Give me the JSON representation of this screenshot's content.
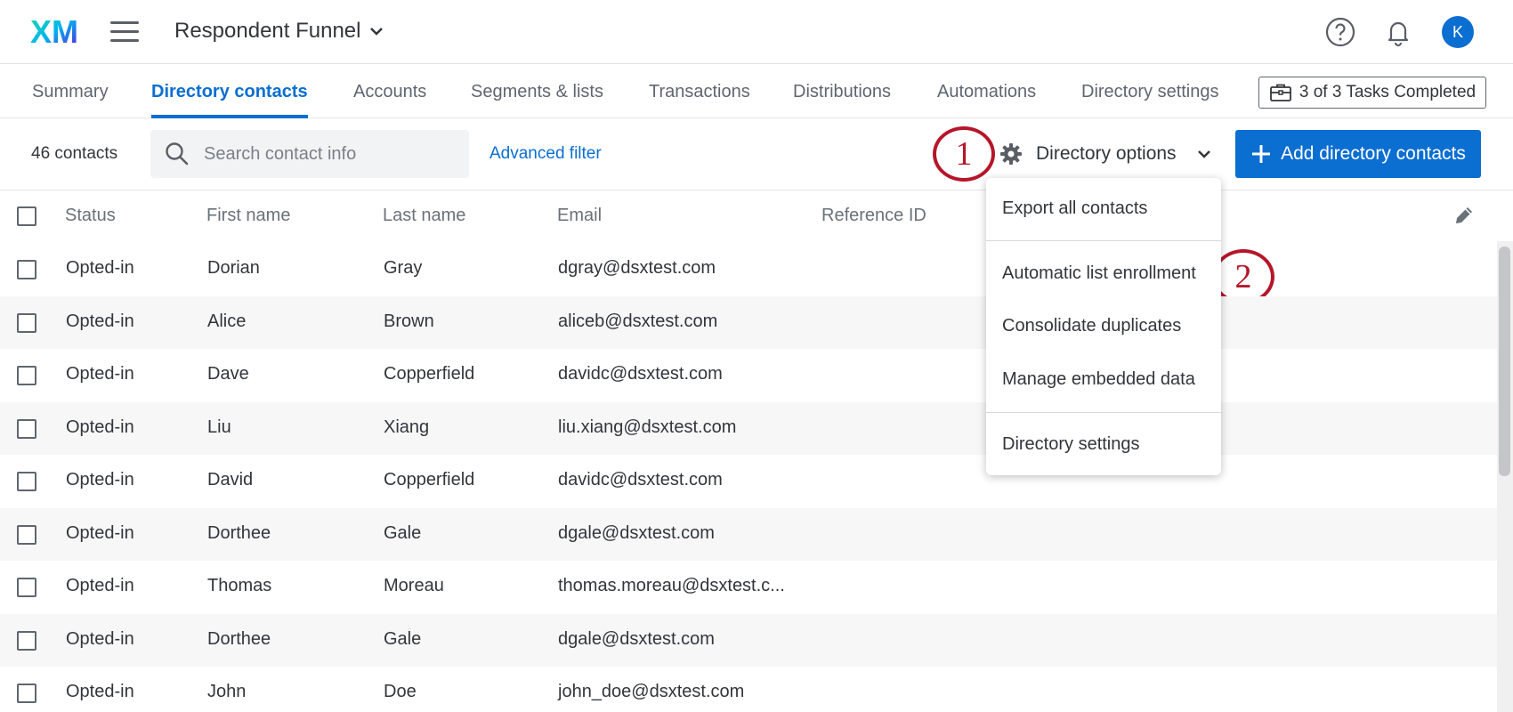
{
  "header": {
    "logo_text": "XM",
    "project_title": "Respondent Funnel",
    "avatar_initial": "K"
  },
  "tabs": [
    {
      "label": "Summary",
      "active": false
    },
    {
      "label": "Directory contacts",
      "active": true
    },
    {
      "label": "Accounts",
      "active": false
    },
    {
      "label": "Segments & lists",
      "active": false
    },
    {
      "label": "Transactions",
      "active": false
    },
    {
      "label": "Distributions",
      "active": false
    },
    {
      "label": "Automations",
      "active": false
    },
    {
      "label": "Directory settings",
      "active": false
    }
  ],
  "tasks": {
    "label": "3 of 3 Tasks Completed"
  },
  "toolbar": {
    "contact_count": "46 contacts",
    "search_placeholder": "Search contact info",
    "advanced_filter": "Advanced filter",
    "directory_options": "Directory options",
    "add_contacts": "Add directory contacts"
  },
  "callouts": {
    "one": "1",
    "two": "2"
  },
  "table": {
    "columns": [
      "Status",
      "First name",
      "Last name",
      "Email",
      "Reference ID"
    ],
    "rows": [
      {
        "status": "Opted-in",
        "first": "Dorian",
        "last": "Gray",
        "email": "dgray@dsxtest.com"
      },
      {
        "status": "Opted-in",
        "first": "Alice",
        "last": "Brown",
        "email": "aliceb@dsxtest.com"
      },
      {
        "status": "Opted-in",
        "first": "Dave",
        "last": "Copperfield",
        "email": "davidc@dsxtest.com"
      },
      {
        "status": "Opted-in",
        "first": "Liu",
        "last": "Xiang",
        "email": "liu.xiang@dsxtest.com"
      },
      {
        "status": "Opted-in",
        "first": "David",
        "last": "Copperfield",
        "email": "davidc@dsxtest.com"
      },
      {
        "status": "Opted-in",
        "first": "Dorthee",
        "last": "Gale",
        "email": "dgale@dsxtest.com"
      },
      {
        "status": "Opted-in",
        "first": "Thomas",
        "last": "Moreau",
        "email": "thomas.moreau@dsxtest.c..."
      },
      {
        "status": "Opted-in",
        "first": "Dorthee",
        "last": "Gale",
        "email": "dgale@dsxtest.com"
      },
      {
        "status": "Opted-in",
        "first": "John",
        "last": "Doe",
        "email": "john_doe@dsxtest.com"
      }
    ]
  },
  "menu": {
    "items": [
      "Export all contacts",
      "Automatic list enrollment",
      "Consolidate duplicates",
      "Manage embedded data",
      "Directory settings"
    ]
  },
  "colors": {
    "accent": "#0b6ed1",
    "callout": "#b5162a",
    "text": "#32363a",
    "muted": "#6a717a"
  },
  "icons": {
    "menu": "hamburger-icon",
    "help": "help-icon",
    "notifications": "bell-icon",
    "search": "search-icon",
    "settings": "gear-icon",
    "add": "plus-icon",
    "edit": "pencil-icon",
    "tasks": "briefcase-icon"
  }
}
